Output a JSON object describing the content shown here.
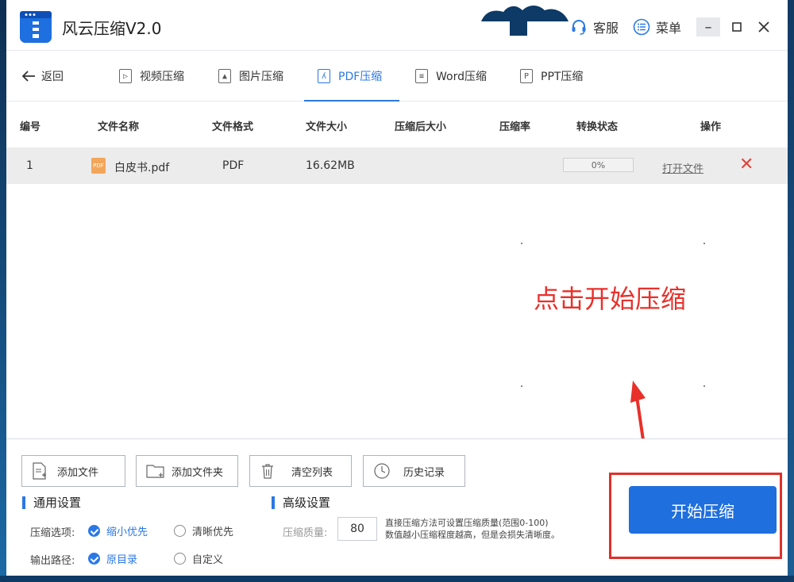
{
  "app": {
    "title": "风云压缩V2.0",
    "customer_service": "客服",
    "menu": "菜单"
  },
  "nav": {
    "back": "返回",
    "tabs": [
      {
        "label": "视频压缩",
        "icon": "video-file-icon"
      },
      {
        "label": "图片压缩",
        "icon": "image-file-icon"
      },
      {
        "label": "PDF压缩",
        "icon": "pdf-file-icon",
        "active": true
      },
      {
        "label": "Word压缩",
        "icon": "word-file-icon"
      },
      {
        "label": "PPT压缩",
        "icon": "ppt-file-icon"
      }
    ]
  },
  "table": {
    "headers": [
      "编号",
      "文件名称",
      "文件格式",
      "文件大小",
      "压缩后大小",
      "压缩率",
      "转换状态",
      "操作"
    ],
    "rows": [
      {
        "index": "1",
        "badge": "PDF",
        "name": "白皮书.pdf",
        "format": "PDF",
        "size": "16.62MB",
        "compressed_size": "",
        "ratio": "",
        "progress_text": "0%",
        "progress": 0,
        "action": "打开文件"
      }
    ]
  },
  "annotation": {
    "hint": "点击开始压缩",
    "color": "#e8302a"
  },
  "toolbar": {
    "add_file": "添加文件",
    "add_folder": "添加文件夹",
    "clear_list": "清空列表",
    "history": "历史记录"
  },
  "general": {
    "title": "通用设置",
    "compress_option_label": "压缩选项:",
    "opt_small": "缩小优先",
    "opt_clear": "清晰优先",
    "output_path_label": "输出路径:",
    "path_original": "原目录",
    "path_custom": "自定义"
  },
  "advanced": {
    "title": "高级设置",
    "quality_label": "压缩质量:",
    "quality_value": "80",
    "desc_line1": "直接压缩方法可设置压缩质量(范围0-100)",
    "desc_line2": "数值越小压缩程度越高，但是会损失清晰度。"
  },
  "start_button": "开始压缩",
  "colors": {
    "accent": "#2b78e4",
    "start_button": "#1f6fde",
    "highlight": "#e0302a"
  }
}
